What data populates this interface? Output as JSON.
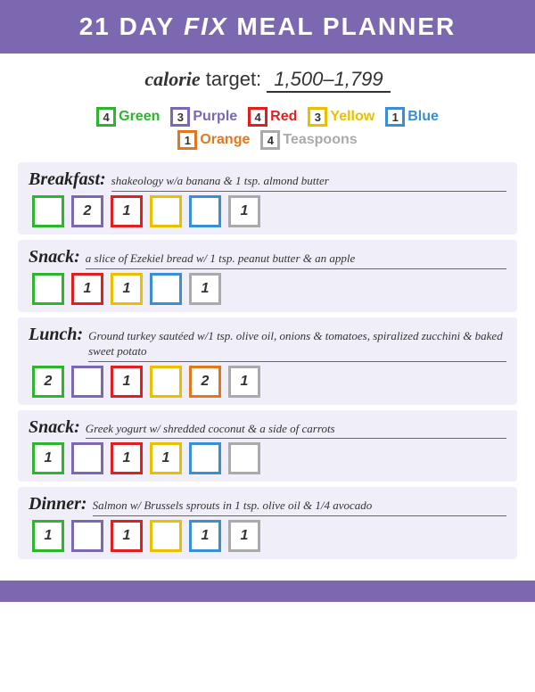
{
  "header": {
    "title_21": "21 DAY",
    "title_fix": "FIX",
    "title_rest": "MEAL PLANNER"
  },
  "calorie": {
    "label_italic": "calorie",
    "label_rest": " target: ",
    "value": "1,500–1,799"
  },
  "targets": {
    "row1": [
      {
        "color": "green",
        "count": "4",
        "label": "Green"
      },
      {
        "color": "purple",
        "count": "3",
        "label": "Purple"
      },
      {
        "color": "red",
        "count": "4",
        "label": "Red"
      },
      {
        "color": "yellow",
        "count": "3",
        "label": "Yellow"
      },
      {
        "color": "blue",
        "count": "1",
        "label": "Blue"
      }
    ],
    "row2": [
      {
        "color": "orange",
        "count": "1",
        "label": "Orange"
      },
      {
        "color": "gray",
        "count": "4",
        "label": "Teaspoons"
      }
    ]
  },
  "meals": [
    {
      "title": "Breakfast:",
      "desc": "shakeology w/a banana & 1 tsp. almond butter",
      "boxes": [
        {
          "color": "green",
          "num": ""
        },
        {
          "color": "purple",
          "num": "2"
        },
        {
          "color": "red",
          "num": "1"
        },
        {
          "color": "yellow",
          "num": ""
        },
        {
          "color": "blue",
          "num": ""
        },
        {
          "color": "gray",
          "num": "1"
        }
      ]
    },
    {
      "title": "Snack:",
      "desc": "a slice of Ezekiel bread w/ 1 tsp. peanut butter & an apple",
      "boxes": [
        {
          "color": "green",
          "num": ""
        },
        {
          "color": "red",
          "num": "1"
        },
        {
          "color": "yellow",
          "num": "1"
        },
        {
          "color": "blue",
          "num": ""
        },
        {
          "color": "gray",
          "num": "1"
        }
      ]
    },
    {
      "title": "Lunch:",
      "desc": "Ground turkey sautéed w/1 tsp. olive oil, onions & tomatoes, spiralized zucchini & baked sweet potato",
      "boxes": [
        {
          "color": "green",
          "num": "2"
        },
        {
          "color": "purple",
          "num": ""
        },
        {
          "color": "red",
          "num": "1"
        },
        {
          "color": "yellow",
          "num": ""
        },
        {
          "color": "orange",
          "num": "2"
        },
        {
          "color": "gray",
          "num": "1"
        }
      ]
    },
    {
      "title": "Snack:",
      "desc": "Greek yogurt w/ shredded coconut & a side of carrots",
      "boxes": [
        {
          "color": "green",
          "num": "1"
        },
        {
          "color": "purple",
          "num": ""
        },
        {
          "color": "red",
          "num": "1"
        },
        {
          "color": "yellow",
          "num": "1"
        },
        {
          "color": "blue",
          "num": ""
        },
        {
          "color": "gray",
          "num": ""
        }
      ]
    },
    {
      "title": "Dinner:",
      "desc": "Salmon w/ Brussels sprouts in 1 tsp. olive oil & 1/4 avocado",
      "boxes": [
        {
          "color": "green",
          "num": "1"
        },
        {
          "color": "purple",
          "num": ""
        },
        {
          "color": "red",
          "num": "1"
        },
        {
          "color": "yellow",
          "num": ""
        },
        {
          "color": "blue",
          "num": "1"
        },
        {
          "color": "gray",
          "num": "1"
        }
      ]
    }
  ],
  "footer": {}
}
